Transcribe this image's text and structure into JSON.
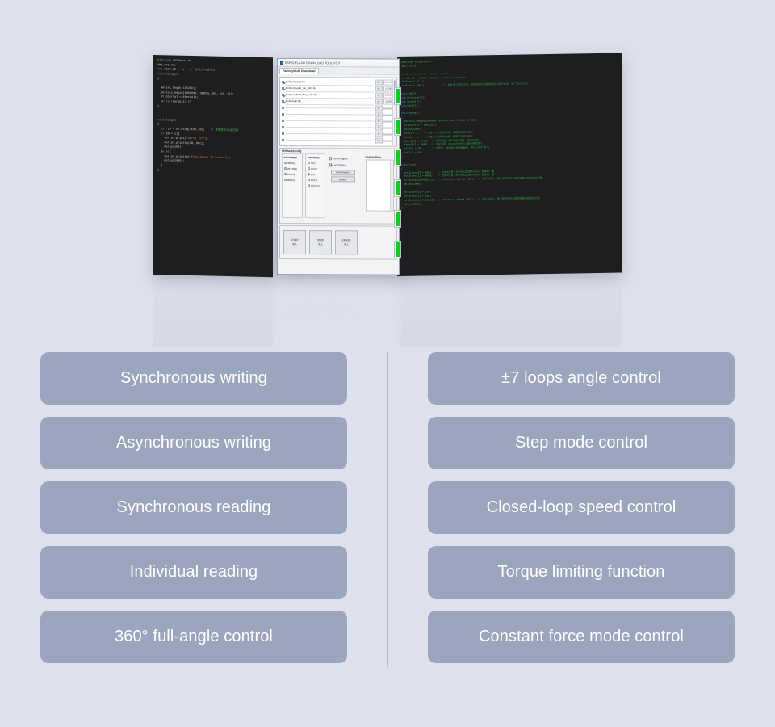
{
  "page": {
    "background_color": "#dee1ec",
    "divider_color": "#b7bdd1"
  },
  "hero": {
    "windows": [
      {
        "name": "arduino-ide-ping-sketch",
        "type": "code-editor",
        "code_lines": [
          "#include <SCServo.h>",
          "SMS_STS st;",
          "int TEST_ID = 1;   // 舵机ID与波特率",
          "void setup()",
          "{",
          "",
          "  Serial.begin(115200);",
          "  Serial1.begin(1000000, SERIAL_8N1, 18, 19);",
          "  st.pSerial = &Serial1;",
          "  while(!Serial1) {}",
          "}",
          "",
          "",
          "void loop()",
          "{",
          "  int ID = st.Ping(TEST_ID);   // 读取舵机ID返回值",
          "  if(ID!=-1){",
          "    Serial.print(\"Servo ID:\");",
          "    Serial.println(ID, DEC);",
          "    delay(100);",
          "  }else{",
          "    Serial.println(\"Ping servo ID error!\");",
          "    delay(2000);",
          "  }",
          "}"
        ]
      },
      {
        "name": "esp32-flash-download-tool",
        "type": "dialog",
        "title": "ESP32 FLASH DOWNLOAD TOOL V3.X",
        "tab": "FactoryMulti Download",
        "files": [
          {
            "checked": true,
            "path": "bin/boot_app0.bin",
            "at": "@",
            "offset": "0x0e000"
          },
          {
            "checked": true,
            "path": "bin/bootloader_dio_40m.bin",
            "at": "@",
            "offset": "0x1000"
          },
          {
            "checked": true,
            "path": "bin/ServoDriverST_huilin.bin",
            "at": "@",
            "offset": "0x10000"
          },
          {
            "checked": true,
            "path": "bin/default.bin",
            "at": "@",
            "offset": "0x8000"
          },
          {
            "checked": false,
            "path": "",
            "at": "@",
            "offset": ""
          },
          {
            "checked": false,
            "path": "",
            "at": "@",
            "offset": ""
          },
          {
            "checked": false,
            "path": "",
            "at": "@",
            "offset": ""
          },
          {
            "checked": false,
            "path": "",
            "at": "@",
            "offset": ""
          },
          {
            "checked": false,
            "path": "",
            "at": "@",
            "offset": ""
          },
          {
            "checked": false,
            "path": "",
            "at": "@",
            "offset": ""
          }
        ],
        "config": {
          "legend": "SPIFlashConfig",
          "speed_label": "SPI SPEED",
          "speed_options": [
            "40MHz",
            "26.7MHz",
            "20MHz",
            "80MHz"
          ],
          "speed_selected": "40MHz",
          "mode_label": "SPI MODE",
          "mode_options": [
            "QIO",
            "QOUT",
            "DIO",
            "DOUT",
            "FASTRD"
          ],
          "mode_selected": "DIO",
          "checkbox_donotchgbin": "DoNotChgBin",
          "checkbox_locksettings": "LockSettings",
          "button_combine": "CombineBin",
          "button_default": "Default",
          "detected_label": "DetectedInfo"
        },
        "actions": [
          {
            "line1": "START",
            "line2": "ALL"
          },
          {
            "line1": "STOP",
            "line2": "ALL"
          },
          {
            "line1": "ERASE",
            "line2": "ALL"
          }
        ],
        "progress_bar_color": "#06d406",
        "progress_bar_count": 6
      },
      {
        "name": "arduino-ide-syncwrite-sketch",
        "type": "code-editor",
        "code_lines": [
          "#include <SCServo.h>",
          "SMS_STS st;",
          "",
          "// We want end to control servo",
          "// STS ID = 1,255 STS ID = 2,255 at default",
          "#define I_ID  1",
          "#define I_TWO 2             // 此处定义舵机ID号，请根据实际连接的舵机ID进行修改，出厂默认ID为1",
          "",
          "byte ID[2];",
          "s16 Position[2];",
          "u16 Speed[2];",
          "byte ACC[2];",
          "",
          "void setup()",
          "{",
          "  Serial1.begin(1000000, SERIAL_8N1, S_RXD, S_TXD);",
          "  st.pSerial = &Serial1;",
          "  delay(1000);",
          "  ID[0] = 1;    // 第一个舵机的ID号，根据实际情况修改",
          "  ID[1] = 2;    // 第二个舵机的ID号，根据实际情况修改",
          "  Speed[0] = 3400;  // 运动速度，0表示最快速度，单位步/秒",
          "  Speed[1] = 3400;  // 运动速度，Speed为0表示以最快速度运行",
          "  ACC[0] = 50;      // 加速度，数值越大加速度越快，单位100步/秒^2",
          "  ACC[1] = 50;",
          "}",
          "",
          "void loop()",
          "{",
          "  Position[0] = 4095;   // 舵机0位置：对应到位置值为4095，即旋转一圈",
          "  Position[1] = 4095;   // 舵机1位置：对应到位置值为4095，即旋转一圈",
          "  st.SyncWritePosEx(ID, 2, Position, Speed, ACC);  // 同步写指令，两个舵机同时以相同速度运动到目标位置",
          "  delay(2000);",
          "",
          "  Position[0] = 100;",
          "  Position[1] = 100;",
          "  st.SyncWritePosEx(ID, 2, Position, Speed, ACC);  // 同步写指令，两个舵机同时以相同速度返回初始位置",
          "  delay(2000);",
          "}"
        ]
      }
    ]
  },
  "features": {
    "left_column": [
      {
        "label": "Synchronous writing"
      },
      {
        "label": "Asynchronous writing"
      },
      {
        "label": "Synchronous reading"
      },
      {
        "label": "Individual reading"
      },
      {
        "label": "360° full-angle control"
      }
    ],
    "right_column": [
      {
        "label": "±7 loops angle control"
      },
      {
        "label": "Step mode control"
      },
      {
        "label": "Closed-loop speed control"
      },
      {
        "label": "Torque limiting function"
      },
      {
        "label": "Constant force mode control"
      }
    ],
    "pill_color": "#9ba5bd",
    "pill_text_color": "#ffffff"
  }
}
